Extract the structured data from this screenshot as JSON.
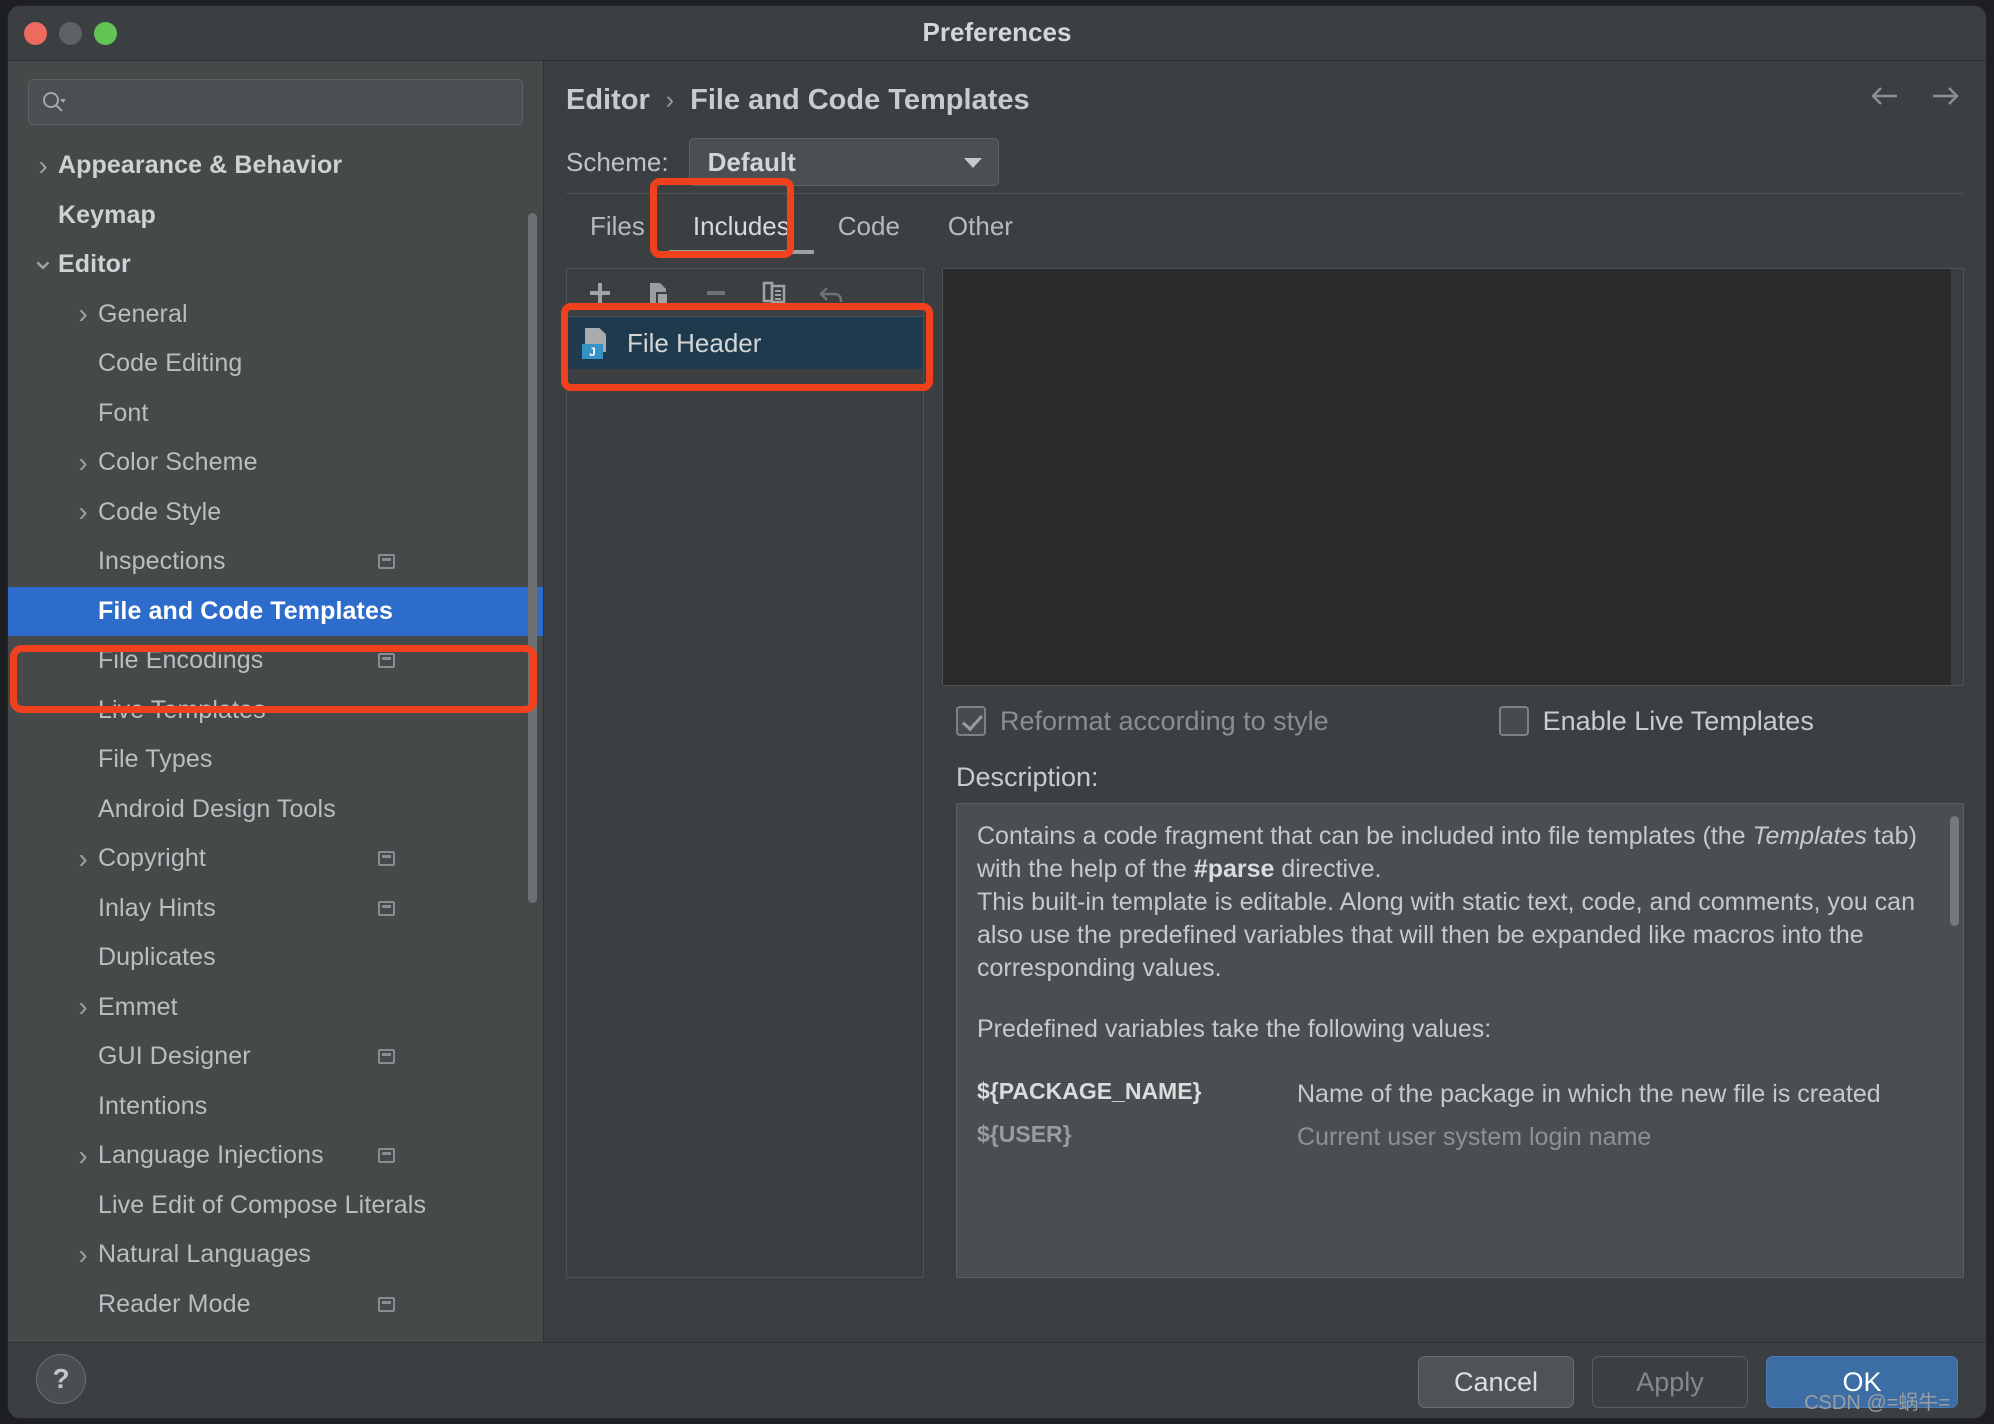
{
  "window": {
    "title": "Preferences",
    "traffic_lights": [
      "close-button",
      "minimize-button",
      "zoom-button"
    ]
  },
  "sidebar": {
    "search": {
      "value": "",
      "placeholder": ""
    },
    "items": [
      {
        "label": "Appearance & Behavior",
        "level": 0,
        "twisty": "collapsed",
        "bold": true,
        "selected": false,
        "config_badge": false
      },
      {
        "label": "Keymap",
        "level": 0,
        "twisty": "none",
        "bold": true,
        "selected": false,
        "config_badge": false
      },
      {
        "label": "Editor",
        "level": 0,
        "twisty": "expanded",
        "bold": true,
        "selected": false,
        "config_badge": false
      },
      {
        "label": "General",
        "level": 1,
        "twisty": "collapsed",
        "bold": false,
        "selected": false,
        "config_badge": false
      },
      {
        "label": "Code Editing",
        "level": 1,
        "twisty": "none",
        "bold": false,
        "selected": false,
        "config_badge": false
      },
      {
        "label": "Font",
        "level": 1,
        "twisty": "none",
        "bold": false,
        "selected": false,
        "config_badge": false
      },
      {
        "label": "Color Scheme",
        "level": 1,
        "twisty": "collapsed",
        "bold": false,
        "selected": false,
        "config_badge": false
      },
      {
        "label": "Code Style",
        "level": 1,
        "twisty": "collapsed",
        "bold": false,
        "selected": false,
        "config_badge": false
      },
      {
        "label": "Inspections",
        "level": 1,
        "twisty": "none",
        "bold": false,
        "selected": false,
        "config_badge": true
      },
      {
        "label": "File and Code Templates",
        "level": 1,
        "twisty": "none",
        "bold": false,
        "selected": true,
        "config_badge": false
      },
      {
        "label": "File Encodings",
        "level": 1,
        "twisty": "none",
        "bold": false,
        "selected": false,
        "config_badge": true
      },
      {
        "label": "Live Templates",
        "level": 1,
        "twisty": "none",
        "bold": false,
        "selected": false,
        "config_badge": false
      },
      {
        "label": "File Types",
        "level": 1,
        "twisty": "none",
        "bold": false,
        "selected": false,
        "config_badge": false
      },
      {
        "label": "Android Design Tools",
        "level": 1,
        "twisty": "none",
        "bold": false,
        "selected": false,
        "config_badge": false
      },
      {
        "label": "Copyright",
        "level": 1,
        "twisty": "collapsed",
        "bold": false,
        "selected": false,
        "config_badge": true
      },
      {
        "label": "Inlay Hints",
        "level": 1,
        "twisty": "none",
        "bold": false,
        "selected": false,
        "config_badge": true
      },
      {
        "label": "Duplicates",
        "level": 1,
        "twisty": "none",
        "bold": false,
        "selected": false,
        "config_badge": false
      },
      {
        "label": "Emmet",
        "level": 1,
        "twisty": "collapsed",
        "bold": false,
        "selected": false,
        "config_badge": false
      },
      {
        "label": "GUI Designer",
        "level": 1,
        "twisty": "none",
        "bold": false,
        "selected": false,
        "config_badge": true
      },
      {
        "label": "Intentions",
        "level": 1,
        "twisty": "none",
        "bold": false,
        "selected": false,
        "config_badge": false
      },
      {
        "label": "Language Injections",
        "level": 1,
        "twisty": "collapsed",
        "bold": false,
        "selected": false,
        "config_badge": true
      },
      {
        "label": "Live Edit of Compose Literals",
        "level": 1,
        "twisty": "none",
        "bold": false,
        "selected": false,
        "config_badge": false
      },
      {
        "label": "Natural Languages",
        "level": 1,
        "twisty": "collapsed",
        "bold": false,
        "selected": false,
        "config_badge": false
      },
      {
        "label": "Reader Mode",
        "level": 1,
        "twisty": "none",
        "bold": false,
        "selected": false,
        "config_badge": true
      }
    ]
  },
  "content": {
    "breadcrumb": {
      "parent": "Editor",
      "separator": "›",
      "current": "File and Code Templates"
    },
    "nav": {
      "back": "back-arrow",
      "forward": "forward-arrow"
    },
    "scheme": {
      "label": "Scheme:",
      "value": "Default"
    },
    "tabs": [
      {
        "label": "Files",
        "active": false
      },
      {
        "label": "Includes",
        "active": true
      },
      {
        "label": "Code",
        "active": false
      },
      {
        "label": "Other",
        "active": false
      }
    ],
    "list_toolbar": [
      {
        "icon": "plus-icon",
        "enabled": true
      },
      {
        "icon": "copy-template-icon",
        "enabled": true
      },
      {
        "icon": "minus-icon",
        "enabled": false
      },
      {
        "icon": "duplicate-icon",
        "enabled": true
      },
      {
        "icon": "undo-icon",
        "enabled": false
      }
    ],
    "templates": [
      {
        "name": "File Header",
        "badge": "J",
        "selected": true
      }
    ],
    "editor": {
      "text": ""
    },
    "checkboxes": [
      {
        "label": "Reformat according to style",
        "checked": true,
        "disabled": true
      },
      {
        "label": "Enable Live Templates",
        "checked": false,
        "disabled": false
      }
    ],
    "description": {
      "title": "Description:",
      "para1_a": "Contains a code fragment that can be included into file templates (the ",
      "para1_em": "Templates",
      "para1_b": " tab) with the help of the ",
      "para1_strong": "#parse",
      "para1_c": " directive.",
      "para2": "This built-in template is editable. Along with static text, code, and comments, you can also use the predefined variables that will then be expanded like macros into the corresponding values.",
      "para3": "Predefined variables take the following values:",
      "variables": [
        {
          "name": "${PACKAGE_NAME}",
          "desc": "Name of the package in which the new file is created"
        },
        {
          "name": "${USER}",
          "desc": "Current user system login name"
        }
      ]
    }
  },
  "footer": {
    "help": "?",
    "buttons": [
      {
        "label": "Cancel",
        "style": "cancel",
        "enabled": true
      },
      {
        "label": "Apply",
        "style": "apply",
        "enabled": false
      },
      {
        "label": "OK",
        "style": "ok",
        "enabled": true
      }
    ],
    "watermark": "CSDN @=蜗牛="
  },
  "colors": {
    "accent_selection": "#2d6ccb",
    "highlight_red": "#f1411c",
    "ok_button": "#3c6ea5",
    "window_bg": "#3c3f41",
    "sidebar_bg": "#45494a",
    "editor_bg": "#2b2b2b"
  }
}
